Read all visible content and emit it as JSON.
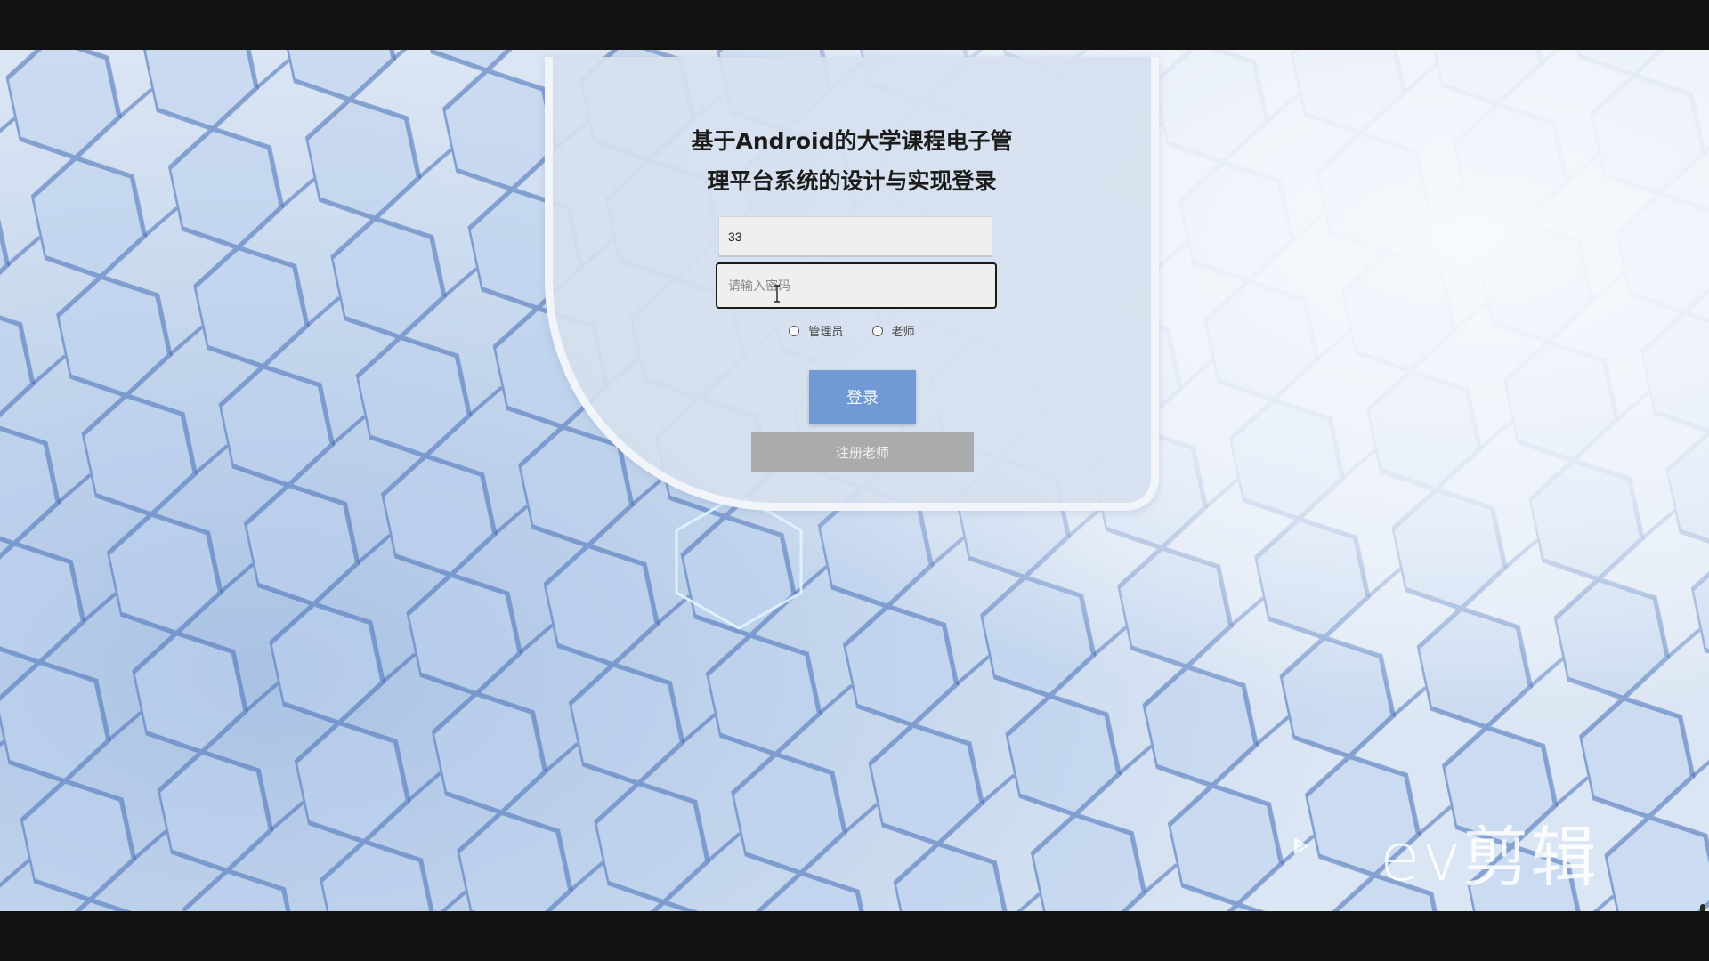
{
  "login": {
    "title_line1": "基于Android的大学课程电子管",
    "title_line2": "理平台系统的设计与实现登录",
    "username_value": "33",
    "password_placeholder": "请输入密码",
    "roles": [
      {
        "label": "管理员",
        "checked": false
      },
      {
        "label": "老师",
        "checked": false
      }
    ],
    "login_label": "登录",
    "register_label": "注册老师"
  },
  "watermark": {
    "text": "ev剪辑"
  },
  "colors": {
    "login_button": "#7199d4",
    "register_button": "#a9abad",
    "panel_bg": "#d6e0ee"
  }
}
